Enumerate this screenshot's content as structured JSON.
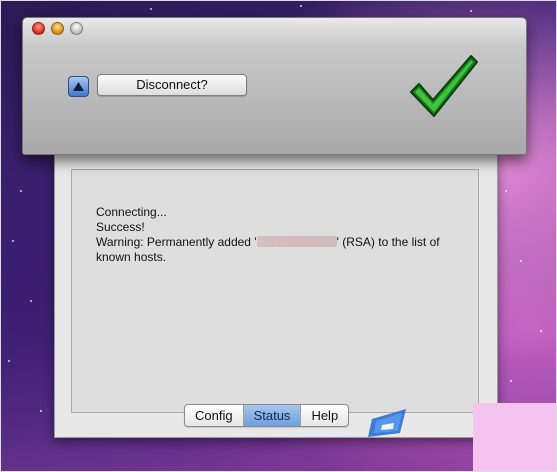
{
  "window": {
    "title": "",
    "disconnect_label": "Disconnect?",
    "status_color": "#2e9a2e"
  },
  "log": {
    "lines": [
      "Connecting...",
      "Success!"
    ],
    "warning_prefix": "Warning: Permanently added '",
    "warning_suffix": "' (RSA) to the list of",
    "warning_line2": "known hosts."
  },
  "tabs": [
    {
      "label": "Config",
      "active": false
    },
    {
      "label": "Status",
      "active": true
    },
    {
      "label": "Help",
      "active": false
    }
  ],
  "icons": {
    "toggle": "triangle-up-icon",
    "status": "checkmark-icon",
    "bottom": "windows-logo-icon"
  }
}
